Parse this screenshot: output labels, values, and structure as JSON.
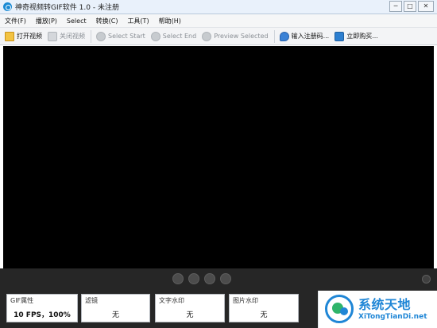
{
  "window": {
    "title": "神奇视频转GIF软件 1.0 - 未注册"
  },
  "menu": [
    "文件(F)",
    "播放(P)",
    "Select",
    "转换(C)",
    "工具(T)",
    "帮助(H)"
  ],
  "toolbar": {
    "open_video": "打开视频",
    "close_video": "关闭视频",
    "select_start": "Select Start",
    "select_end": "Select End",
    "preview_selected": "Preview Selected",
    "enter_code": "输入注册码...",
    "buy_now": "立即购买..."
  },
  "panels": {
    "gif": {
      "label": "GIF属性",
      "value": "10 FPS，100%"
    },
    "filter": {
      "label": "滤镜",
      "value": "无"
    },
    "text_watermark": {
      "label": "文字水印",
      "value": "无"
    },
    "image_watermark": {
      "label": "图片水印",
      "value": "无"
    }
  },
  "watermark": {
    "title": "系统天地",
    "subtitle": "XiTongTianDi.net"
  },
  "colors": {
    "brand": "#1f86d6",
    "video_bg": "#000000",
    "bottom_bg": "#262626"
  }
}
